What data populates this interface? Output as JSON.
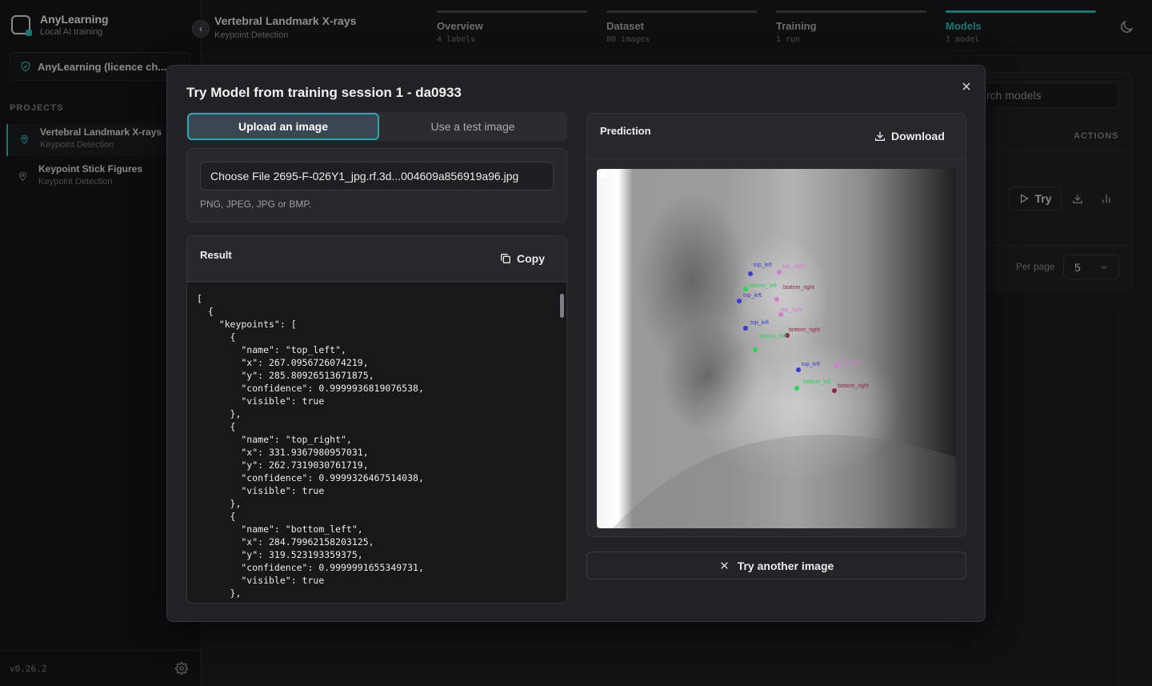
{
  "app": {
    "name": "AnyLearning",
    "tagline": "Local AI training"
  },
  "licence": {
    "label": "AnyLearning (licence ch..."
  },
  "projects": {
    "header": "PROJECTS",
    "items": [
      {
        "name": "Vertebral Landmark X-rays",
        "type": "Keypoint Detection",
        "active": true
      },
      {
        "name": "Keypoint Stick Figures",
        "type": "Keypoint Detection",
        "active": false
      }
    ]
  },
  "version": "v0.26.2",
  "page": {
    "title": "Vertebral Landmark X-rays",
    "subtitle": "Keypoint Detection"
  },
  "steps": [
    {
      "name": "Overview",
      "meta": "4 labels"
    },
    {
      "name": "Dataset",
      "meta": "80 images"
    },
    {
      "name": "Training",
      "meta": "1 run"
    },
    {
      "name": "Models",
      "meta": "1 model"
    }
  ],
  "background": {
    "search_placeholder": "rch models",
    "actions_header": "ACTIONS",
    "try_label": "Try",
    "per_page_label": "Per page",
    "per_page_value": "5"
  },
  "modal": {
    "title": "Try Model from training session 1 - da0933",
    "tabs": {
      "upload": "Upload an image",
      "test": "Use a test image"
    },
    "file_input": "Choose File 2695-F-026Y1_jpg.rf.3d...004609a856919a96.jpg",
    "file_hint": "PNG, JPEG, JPG or BMP.",
    "result": {
      "title": "Result",
      "copy_label": "Copy",
      "json_text": "[\n  {\n    \"keypoints\": [\n      {\n        \"name\": \"top_left\",\n        \"x\": 267.0956726074219,\n        \"y\": 285.80926513671875,\n        \"confidence\": 0.9999936819076538,\n        \"visible\": true\n      },\n      {\n        \"name\": \"top_right\",\n        \"x\": 331.9367980957031,\n        \"y\": 262.7319030761719,\n        \"confidence\": 0.9999326467514038,\n        \"visible\": true\n      },\n      {\n        \"name\": \"bottom_left\",\n        \"x\": 284.79962158203125,\n        \"y\": 319.523193359375,\n        \"confidence\": 0.9999991655349731,\n        \"visible\": true\n      },"
    },
    "prediction": {
      "title": "Prediction",
      "download_label": "Download",
      "labels": {
        "tl": "top_left",
        "tr": "top_right",
        "bl": "bottom_left",
        "br": "bottom_right"
      }
    },
    "try_another_label": "Try another image"
  },
  "colors": {
    "accent": "#2bb3b1",
    "kp_top_left": "#3a3ad6",
    "kp_top_right": "#d77ad1",
    "kp_bottom_left": "#2ed15c",
    "kp_bottom_right": "#8e2448"
  }
}
